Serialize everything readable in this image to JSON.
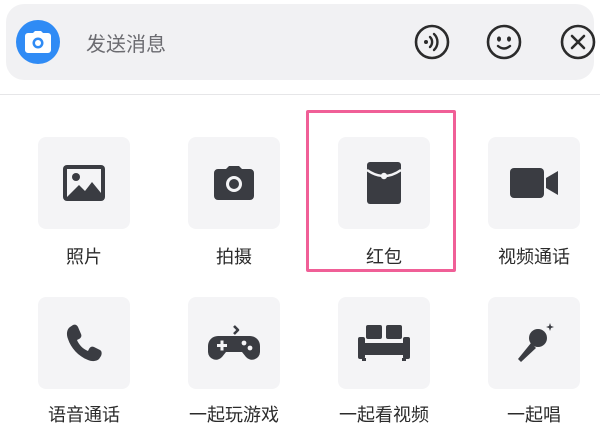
{
  "input_bar": {
    "placeholder": "发送消息",
    "icons": [
      "camera-icon",
      "voice-icon",
      "emoji-icon",
      "close-icon"
    ]
  },
  "panel": {
    "items": [
      {
        "label": "照片",
        "icon": "photo-icon"
      },
      {
        "label": "拍摄",
        "icon": "camera-icon"
      },
      {
        "label": "红包",
        "icon": "red-envelope-icon",
        "highlighted": true
      },
      {
        "label": "视频通话",
        "icon": "video-call-icon"
      },
      {
        "label": "语音通话",
        "icon": "phone-icon"
      },
      {
        "label": "一起玩游戏",
        "icon": "gamepad-icon"
      },
      {
        "label": "一起看视频",
        "icon": "sofa-icon"
      },
      {
        "label": "一起唱",
        "icon": "microphone-icon"
      }
    ]
  },
  "colors": {
    "accent_blue": "#2f8bf5",
    "highlight_pink": "#f05f97",
    "icon_dark": "#3a3c42",
    "tile_bg": "#f4f4f6"
  }
}
